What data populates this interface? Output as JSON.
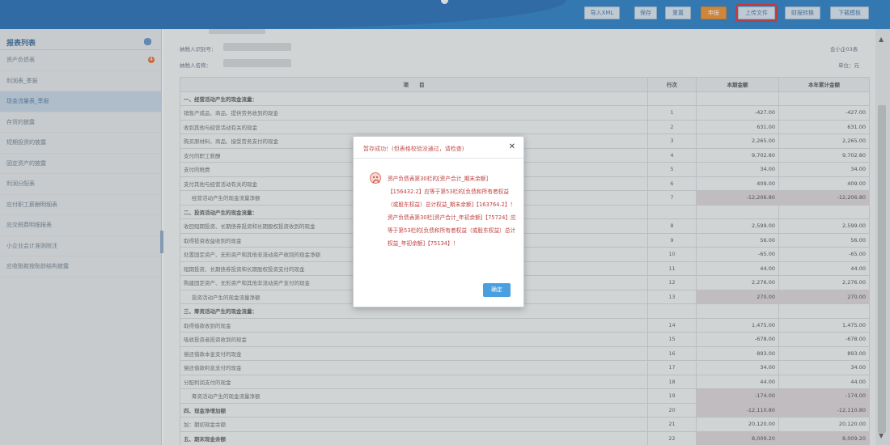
{
  "toolbar": {
    "buttons": [
      "导入XML",
      "保存",
      "重置",
      "申报",
      "上传文件",
      "财报转换",
      "下载模板"
    ]
  },
  "sidebar": {
    "title": "报表列表",
    "items": [
      {
        "label": "资产负债表",
        "badge": "4"
      },
      {
        "label": "利润表_季报"
      },
      {
        "label": "现金流量表_季报"
      },
      {
        "label": "存货的披露"
      },
      {
        "label": "短期投资的披露"
      },
      {
        "label": "固定资产的披露"
      },
      {
        "label": "利润分配表"
      },
      {
        "label": "应付职工薪酬明细表"
      },
      {
        "label": "应交税费明细报表"
      },
      {
        "label": "小企业会计准则附注"
      },
      {
        "label": "应收账款按账龄结构披露"
      }
    ]
  },
  "header": {
    "taxpayer_id_label": "纳税人识别号：",
    "taxpayer_name_label": "纳税人名称：",
    "form_code": "会小企03表",
    "unit": "单位：元"
  },
  "table": {
    "columns": [
      "项　　目",
      "行次",
      "本期金额",
      "本年累计金额"
    ],
    "rows": [
      {
        "name": "一、经营活动产生的现金流量：",
        "line": "",
        "current": "",
        "ytd": "",
        "type": "sec"
      },
      {
        "name": "销售产成品、商品、提供劳务收到的现金",
        "line": "1",
        "current": "-427.00",
        "ytd": "-427.00"
      },
      {
        "name": "收到其他与经营活动有关的现金",
        "line": "2",
        "current": "631.00",
        "ytd": "631.00"
      },
      {
        "name": "购买原材料、商品、接受劳务支付的现金",
        "line": "3",
        "current": "2,265.00",
        "ytd": "2,265.00"
      },
      {
        "name": "支付的职工薪酬",
        "line": "4",
        "current": "9,702.80",
        "ytd": "9,702.80"
      },
      {
        "name": "支付的税费",
        "line": "5",
        "current": "34.00",
        "ytd": "34.00"
      },
      {
        "name": "支付其他与经营活动有关的现金",
        "line": "6",
        "current": "409.00",
        "ytd": "409.00"
      },
      {
        "name": "经营活动产生的现金流量净额",
        "line": "7",
        "current": "-12,206.80",
        "ytd": "-12,206.80",
        "type": "sub",
        "shade": true
      },
      {
        "name": "二、投资活动产生的现金流量：",
        "line": "",
        "current": "",
        "ytd": "",
        "type": "sec"
      },
      {
        "name": "收回短期投资、长期债券投资和长期股权投资收到的现金",
        "line": "8",
        "current": "2,599.00",
        "ytd": "2,599.00"
      },
      {
        "name": "取得投资收益收到的现金",
        "line": "9",
        "current": "56.00",
        "ytd": "56.00"
      },
      {
        "name": "处置固定资产、无形资产和其他非流动资产收回的现金净额",
        "line": "10",
        "current": "-65.00",
        "ytd": "-65.00"
      },
      {
        "name": "短期投资、长期债券投资和长期股权投资支付的现金",
        "line": "11",
        "current": "44.00",
        "ytd": "44.00"
      },
      {
        "name": "购建固定资产、无形资产和其他非流动资产支付的现金",
        "line": "12",
        "current": "2,276.00",
        "ytd": "2,276.00"
      },
      {
        "name": "投资活动产生的现金流量净额",
        "line": "13",
        "current": "270.00",
        "ytd": "270.00",
        "type": "sub",
        "shade": true
      },
      {
        "name": "三、筹资活动产生的现金流量：",
        "line": "",
        "current": "",
        "ytd": "",
        "type": "sec"
      },
      {
        "name": "取得借款收到的现金",
        "line": "14",
        "current": "1,475.00",
        "ytd": "1,475.00"
      },
      {
        "name": "吸收投资者投资收到的现金",
        "line": "15",
        "current": "-678.00",
        "ytd": "-678.00"
      },
      {
        "name": "偿还借款本金支付的现金",
        "line": "16",
        "current": "893.00",
        "ytd": "893.00"
      },
      {
        "name": "偿还借款利息支付的现金",
        "line": "17",
        "current": "34.00",
        "ytd": "34.00"
      },
      {
        "name": "分配利润支付的现金",
        "line": "18",
        "current": "44.00",
        "ytd": "44.00"
      },
      {
        "name": "筹资活动产生的现金流量净额",
        "line": "19",
        "current": "-174.00",
        "ytd": "-174.00",
        "type": "sub",
        "shade": true
      },
      {
        "name": "四、现金净增加额",
        "line": "20",
        "current": "-12,110.80",
        "ytd": "-12,110.80",
        "type": "sec",
        "shade": true
      },
      {
        "name": "加：期初现金余额",
        "line": "21",
        "current": "20,120.00",
        "ytd": "20,120.00"
      },
      {
        "name": "五、期末现金余额",
        "line": "22",
        "current": "8,009.20",
        "ytd": "8,009.20",
        "type": "sec",
        "shade": true
      }
    ]
  },
  "modal": {
    "title": "暂存成功！(但表格校验没通过，请检查)",
    "message": "资产负债表第30栏的[资产合计_期末余额]【156432.2】应等于第53栏的[负债和所有者权益（或股东权益）总计权益_期末余额]【163764.2】！\n资产负债表第30栏[资产合计_年初余额]【75724】应等于第53栏的[负债和所有者权益（或股东权益）总计权益_年初余额]【75134】！",
    "ok_label": "确定"
  },
  "colors": {
    "topbar": "#1b76c4",
    "declare_button": "#f08a1f",
    "highlight_outline": "#e02020",
    "error_text": "#c04040",
    "ok_button": "#4a9fe0"
  }
}
